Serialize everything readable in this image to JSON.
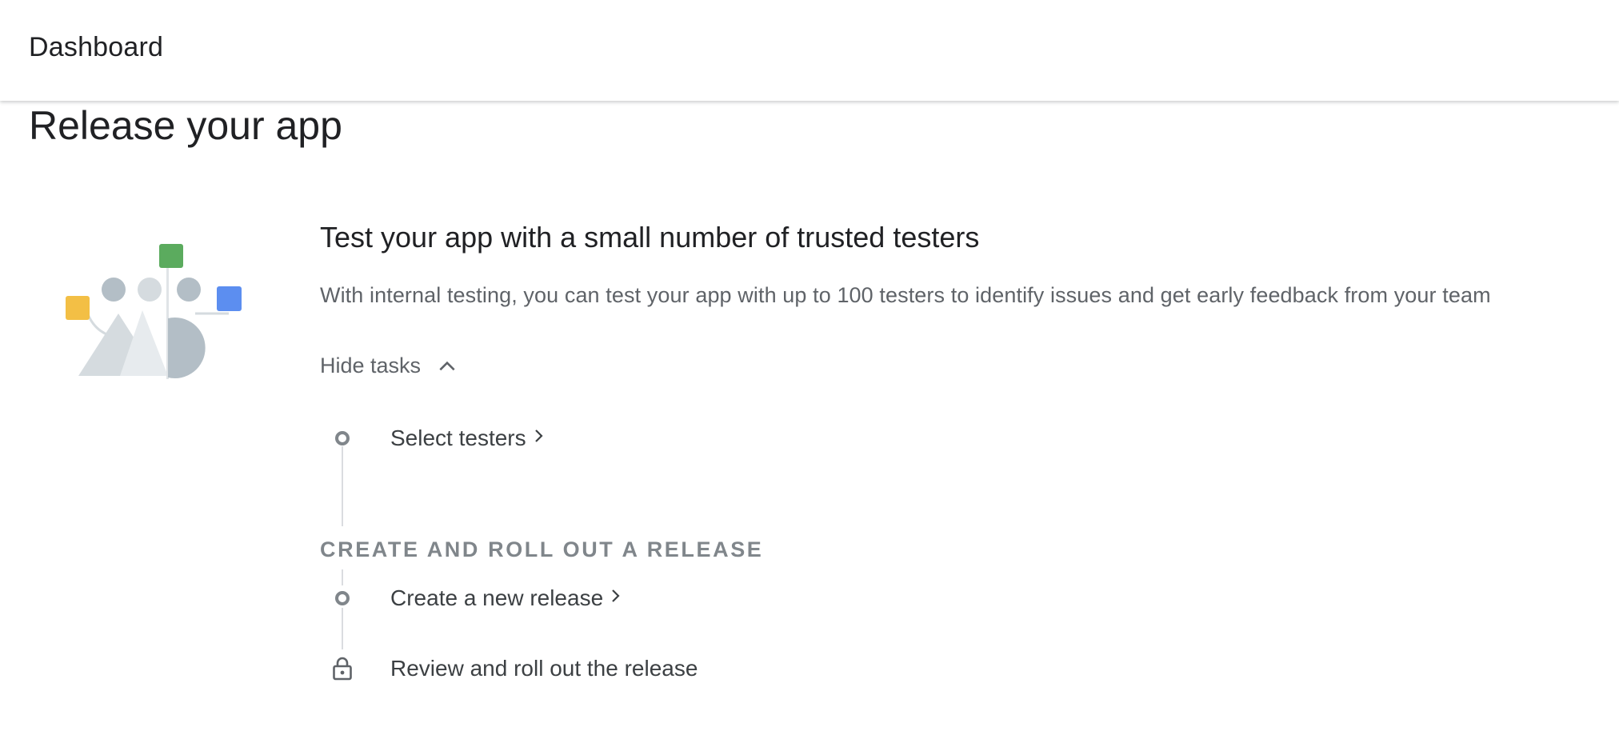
{
  "header": {
    "title": "Dashboard"
  },
  "page": {
    "title": "Release your app"
  },
  "card": {
    "heading": "Test your app with a small number of trusted testers",
    "description": "With internal testing, you can test your app with up to 100 testers to identify issues and get early feedback from your team",
    "toggle_label": "Hide tasks",
    "toggle_icon": "chevron-up-icon"
  },
  "tasks": {
    "select_testers": {
      "label": "Select testers",
      "status_icon": "circle-outline-icon",
      "link_icon": "chevron-right-icon"
    },
    "section_label": "CREATE AND ROLL OUT A RELEASE",
    "create_release": {
      "label": "Create a new release",
      "status_icon": "circle-outline-icon",
      "link_icon": "chevron-right-icon"
    },
    "review_release": {
      "label": "Review and roll out the release",
      "status_icon": "lock-icon"
    }
  },
  "colors": {
    "accent_green": "#5bab5e",
    "accent_yellow": "#f3bf45",
    "accent_blue": "#5c8ef0",
    "illustration_gray": "#b3bec6",
    "illustration_light_gray": "#d5dbdf",
    "text_primary": "#202124",
    "text_secondary": "#5f6368",
    "icon_gray": "#80868b"
  }
}
